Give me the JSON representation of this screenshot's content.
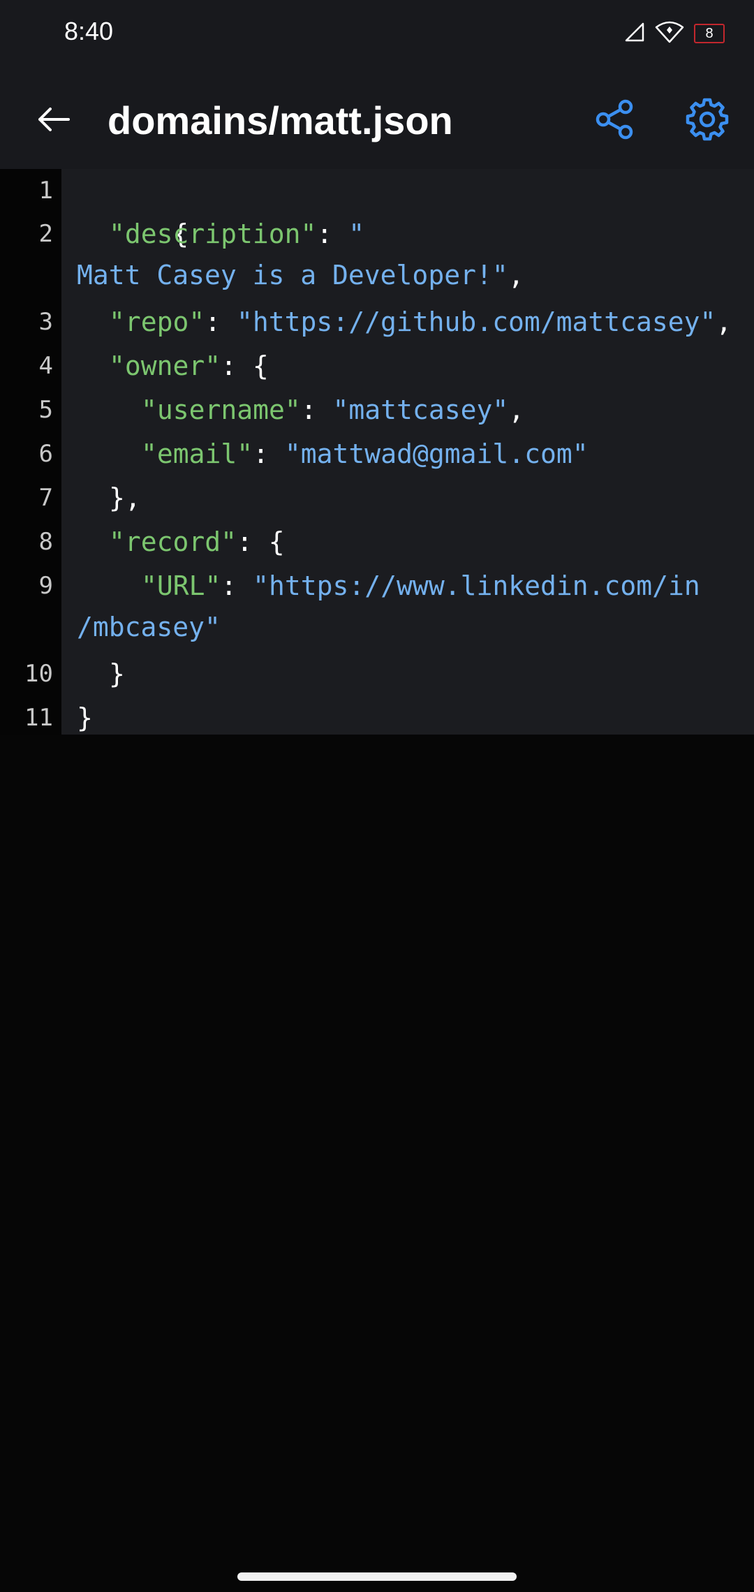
{
  "status_bar": {
    "time": "8:40",
    "battery": "8",
    "icons": [
      "signal-icon",
      "wifi-icon",
      "battery-icon"
    ]
  },
  "app_bar": {
    "title": "domains/matt.json",
    "back_icon": "arrow-left-icon",
    "share_icon": "share-icon",
    "settings_icon": "gear-icon",
    "accent_color": "#3b8ff0"
  },
  "editor": {
    "line_numbers": [
      "1",
      "2",
      "3",
      "4",
      "5",
      "6",
      "7",
      "8",
      "9",
      "10",
      "11"
    ],
    "lines": {
      "l1": {
        "open": "{"
      },
      "l2": {
        "key": "\"description\"",
        "sep": ": ",
        "val_a": "\""
      },
      "l2b": {
        "val_b": "Matt Casey is a Developer!\"",
        "end": ","
      },
      "l3": {
        "key": "\"repo\"",
        "sep": ": ",
        "val": "\"https://github.com/mattcasey\"",
        "end": ","
      },
      "l4": {
        "key": "\"owner\"",
        "sep": ": ",
        "open": "{"
      },
      "l5": {
        "key": "\"username\"",
        "sep": ": ",
        "val": "\"mattcasey\"",
        "end": ","
      },
      "l6": {
        "key": "\"email\"",
        "sep": ": ",
        "val": "\"mattwad@gmail.com\""
      },
      "l7": {
        "close": "},"
      },
      "l8": {
        "key": "\"record\"",
        "sep": ": ",
        "open": "{"
      },
      "l9": {
        "key": "\"URL\"",
        "sep": ": ",
        "val_a": "\"https://www.linkedin.com/in"
      },
      "l9b": {
        "val_b": "/mbcasey\""
      },
      "l10": {
        "close": "}"
      },
      "l11": {
        "close": "}"
      }
    },
    "colors": {
      "key": "#7cc66f",
      "string": "#74b1ee",
      "punctuation": "#ffffff",
      "line_number": "#c8c8c8",
      "background": "#1b1c20"
    }
  }
}
